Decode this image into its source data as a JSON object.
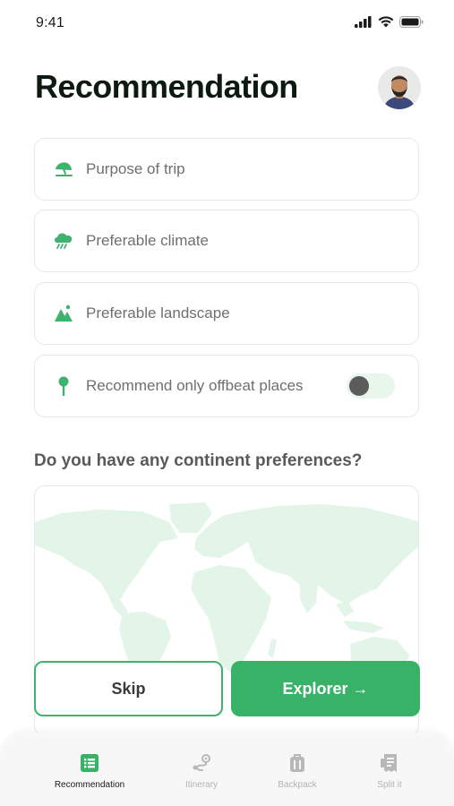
{
  "status_bar": {
    "time": "9:41"
  },
  "header": {
    "title": "Recommendation"
  },
  "fields": [
    {
      "label": "Purpose of trip",
      "icon": "umbrella-icon"
    },
    {
      "label": "Preferable climate",
      "icon": "cloud-rain-icon"
    },
    {
      "label": "Preferable landscape",
      "icon": "mountain-icon"
    },
    {
      "label": "Recommend only offbeat places",
      "icon": "pin-icon",
      "toggle_on": false
    }
  ],
  "continent_section": {
    "title": "Do you have any continent preferences?"
  },
  "buttons": {
    "skip": "Skip",
    "explore": "Explorer →"
  },
  "bottom_nav": {
    "items": [
      {
        "label": "Recommendation",
        "icon": "list-icon",
        "active": true
      },
      {
        "label": "Itinerary",
        "icon": "route-icon",
        "active": false
      },
      {
        "label": "Backpack",
        "icon": "backpack-icon",
        "active": false
      },
      {
        "label": "Split it",
        "icon": "receipt-icon",
        "active": false
      }
    ]
  },
  "colors": {
    "accent": "#37b267",
    "map_fill": "#e3f5e8",
    "text_muted": "#6f6f6f"
  }
}
